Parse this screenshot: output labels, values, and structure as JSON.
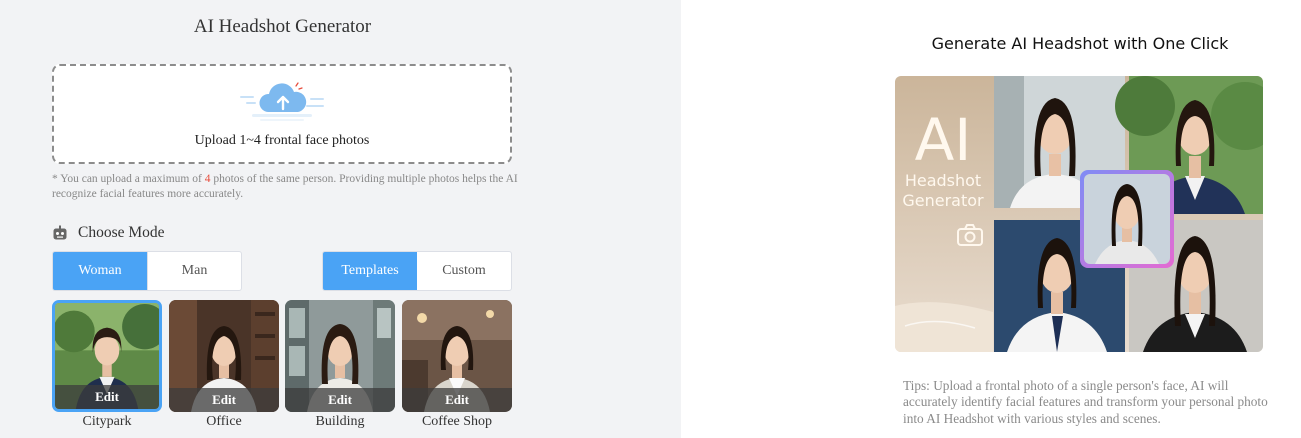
{
  "left": {
    "title": "AI Headshot Generator",
    "upload": {
      "text": "Upload 1~4 frontal face photos",
      "icon": "cloud-upload-icon"
    },
    "note": {
      "prefix": "* You can upload a maximum of ",
      "count": "4",
      "suffix": " photos of the same person. Providing multiple photos helps the AI recognize facial features more accurately."
    },
    "mode": {
      "icon": "robot-icon",
      "label": "Choose Mode"
    },
    "gender": {
      "options": [
        "Woman",
        "Man"
      ],
      "selected": "Woman"
    },
    "type": {
      "options": [
        "Templates",
        "Custom"
      ],
      "selected": "Templates"
    },
    "templates": [
      {
        "label": "Citypark",
        "edit": "Edit",
        "selected": true
      },
      {
        "label": "Office",
        "edit": "Edit",
        "selected": false
      },
      {
        "label": "Building",
        "edit": "Edit",
        "selected": false
      },
      {
        "label": "Coffee Shop",
        "edit": "Edit",
        "selected": false
      }
    ]
  },
  "right": {
    "title": "Generate AI Headshot with One Click",
    "showcase": {
      "big_text": "AI",
      "line1": "Headshot",
      "line2": "Generator",
      "icon": "camera-icon"
    },
    "tips": "Tips: Upload a frontal photo of a single person's face, AI will accurately identify facial features and transform your personal photo into AI Headshot with various styles and scenes."
  },
  "colors": {
    "accent": "#4aa3f5",
    "highlight": "#e74c3c",
    "panel_bg": "#f2f3f5"
  }
}
